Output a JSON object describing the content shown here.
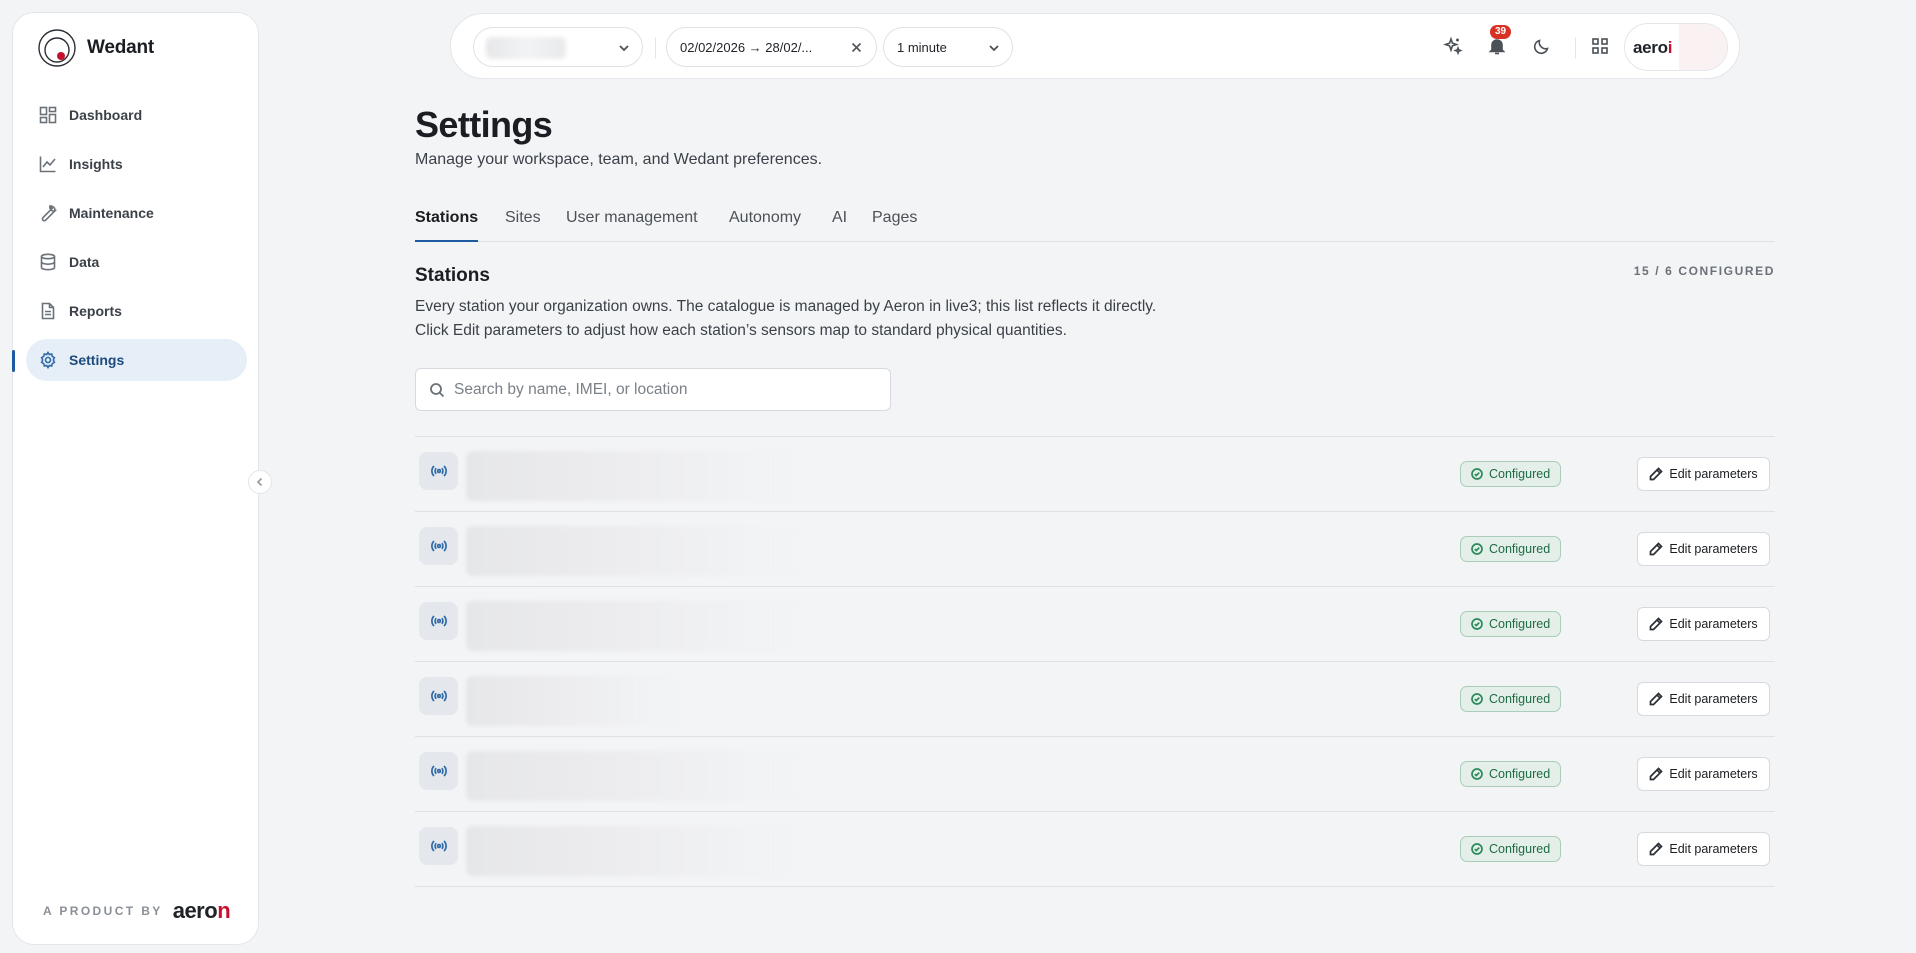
{
  "app": {
    "name": "Wedant"
  },
  "sidebar": {
    "items": [
      {
        "label": "Dashboard",
        "icon": "dashboard-icon"
      },
      {
        "label": "Insights",
        "icon": "chart-line-icon"
      },
      {
        "label": "Maintenance",
        "icon": "wrench-icon"
      },
      {
        "label": "Data",
        "icon": "database-icon"
      },
      {
        "label": "Reports",
        "icon": "document-icon"
      },
      {
        "label": "Settings",
        "icon": "gear-icon",
        "active": true
      }
    ],
    "footer_label": "A PRODUCT BY",
    "footer_brand": "aeron"
  },
  "topbar": {
    "date_range": "02/02/2026 → 28/02/...",
    "interval": "1 minute",
    "notification_count": "39",
    "account_text": "aeroi"
  },
  "page": {
    "title": "Settings",
    "subtitle": "Manage your workspace, team, and Wedant preferences."
  },
  "tabs": [
    {
      "label": "Stations",
      "active": true
    },
    {
      "label": "Sites"
    },
    {
      "label": "User management"
    },
    {
      "label": "Autonomy"
    },
    {
      "label": "AI"
    },
    {
      "label": "Pages"
    }
  ],
  "stations": {
    "title": "Stations",
    "count": "15 / 6 CONFIGURED",
    "desc_line1": "Every station your organization owns. The catalogue is managed by Aeron in live3; this list reflects it directly.",
    "desc_line2": "Click Edit parameters to adjust how each station’s sensors map to standard physical quantities.",
    "search_placeholder": "Search by name, IMEI, or location",
    "status_label": "Configured",
    "edit_label": "Edit parameters",
    "rows": 6
  },
  "colors": {
    "accent": "#1e5aa0",
    "status_bg": "#e3efe8",
    "status_text": "#1e6b45",
    "badge": "#d93025",
    "brand_red": "#c8102e"
  }
}
